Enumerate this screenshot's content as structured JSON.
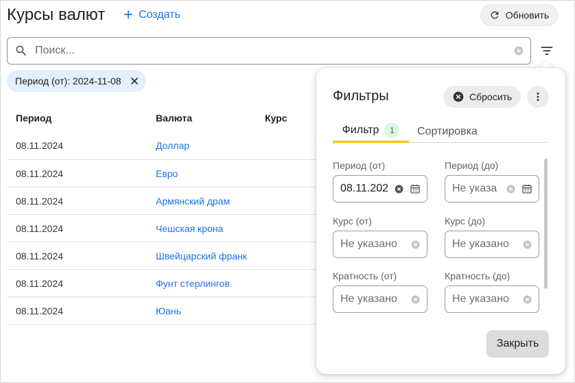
{
  "header": {
    "title": "Курсы валют",
    "create_label": "Создать",
    "refresh_label": "Обновить"
  },
  "search": {
    "placeholder": "Поиск...",
    "value": ""
  },
  "chip": {
    "label": "Период (от): 2024-11-08"
  },
  "table": {
    "columns": [
      "Период",
      "Валюта",
      "Курс"
    ],
    "rows": [
      {
        "period": "08.11.2024",
        "currency": "Доллар",
        "rate": ""
      },
      {
        "period": "08.11.2024",
        "currency": "Евро",
        "rate": ""
      },
      {
        "period": "08.11.2024",
        "currency": "Армянский драм",
        "rate": ""
      },
      {
        "period": "08.11.2024",
        "currency": "Чешская крона",
        "rate": ""
      },
      {
        "period": "08.11.2024",
        "currency": "Швейцарский франк",
        "rate": ""
      },
      {
        "period": "08.11.2024",
        "currency": "Фунт стерлингов",
        "rate": ""
      },
      {
        "period": "08.11.2024",
        "currency": "Юань",
        "rate": ""
      }
    ]
  },
  "filters": {
    "title": "Фильтры",
    "reset_label": "Сбросить",
    "tabs": [
      {
        "label": "Фильтр",
        "badge": "1"
      },
      {
        "label": "Сортировка"
      }
    ],
    "fields": {
      "period_from": {
        "label": "Период (от)",
        "value": "08.11.202"
      },
      "period_to": {
        "label": "Период (до)",
        "placeholder": "Не указа"
      },
      "rate_from": {
        "label": "Курс (от)",
        "placeholder": "Не указано"
      },
      "rate_to": {
        "label": "Курс (до)",
        "placeholder": "Не указано"
      },
      "mult_from": {
        "label": "Кратность (от)",
        "placeholder": "Не указано"
      },
      "mult_to": {
        "label": "Кратность (до)",
        "placeholder": "Не указано"
      }
    },
    "close_label": "Закрыть"
  },
  "colors": {
    "accent": "#1a73e8",
    "tab_indicator": "#f2c200",
    "chip_bg": "#e3effc",
    "badge_bg": "#dff4e3"
  }
}
